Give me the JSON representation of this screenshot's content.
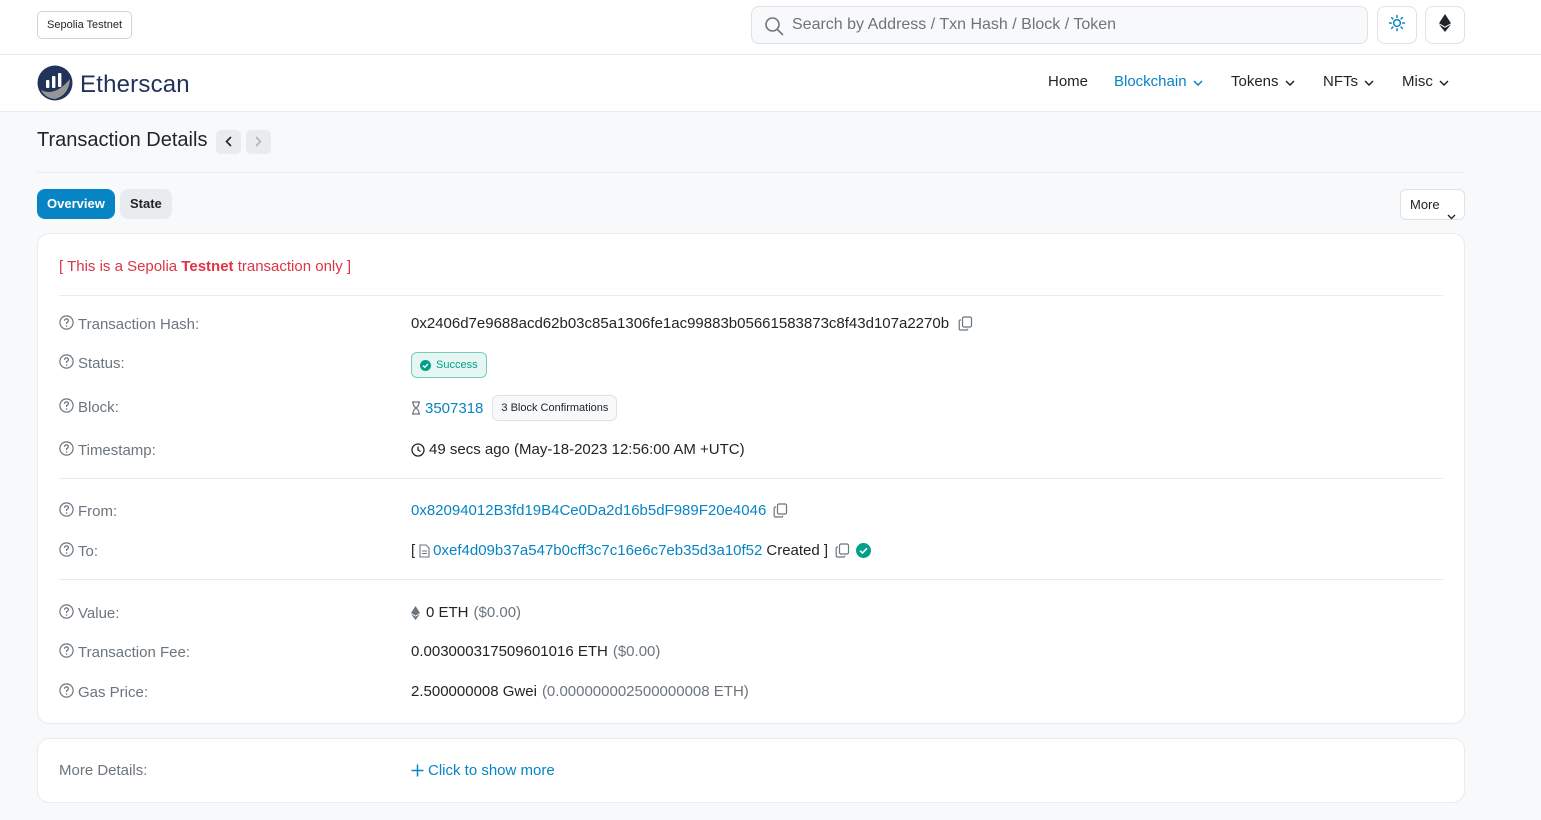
{
  "topbar": {
    "network_badge": "Sepolia Testnet",
    "search_placeholder": "Search by Address / Txn Hash / Block / Token"
  },
  "navbar": {
    "brand": "Etherscan",
    "items": [
      {
        "label": "Home",
        "active": false,
        "dropdown": false
      },
      {
        "label": "Blockchain",
        "active": true,
        "dropdown": true
      },
      {
        "label": "Tokens",
        "active": false,
        "dropdown": true
      },
      {
        "label": "NFTs",
        "active": false,
        "dropdown": true
      },
      {
        "label": "Misc",
        "active": false,
        "dropdown": true
      }
    ]
  },
  "page": {
    "title": "Transaction Details",
    "tabs": [
      "Overview",
      "State"
    ],
    "more_label": "More"
  },
  "notice": {
    "prefix": "[ This is a Sepolia ",
    "strong": "Testnet",
    "suffix": " transaction only ]"
  },
  "details": {
    "tx_hash_label": "Transaction Hash:",
    "tx_hash": "0x2406d7e9688acd62b03c85a1306fe1ac99883b05661583873c8f43d107a2270b",
    "status_label": "Status:",
    "status": "Success",
    "block_label": "Block:",
    "block": "3507318",
    "confirmations": "3 Block Confirmations",
    "timestamp_label": "Timestamp:",
    "timestamp": "49 secs ago (May-18-2023 12:56:00 AM +UTC)",
    "from_label": "From:",
    "from": "0x82094012B3fd19B4Ce0Da2d16b5dF989F20e4046",
    "to_label": "To:",
    "to_open": "[",
    "to": "0xef4d09b37a547b0cff3c7c16e6c7eb35d3a10f52",
    "to_created": "Created ]",
    "value_label": "Value:",
    "value": "0 ETH",
    "value_usd": "($0.00)",
    "fee_label": "Transaction Fee:",
    "fee": "0.003000317509601016 ETH",
    "fee_usd": "($0.00)",
    "gas_label": "Gas Price:",
    "gas": "2.500000008 Gwei",
    "gas_eth": "(0.000000002500000008 ETH)"
  },
  "more_details": {
    "label": "More Details:",
    "link": "Click to show more"
  },
  "colors": {
    "primary": "#0784c3",
    "success": "#00a186",
    "danger": "#dc3545",
    "brand_navy": "#21325b"
  }
}
